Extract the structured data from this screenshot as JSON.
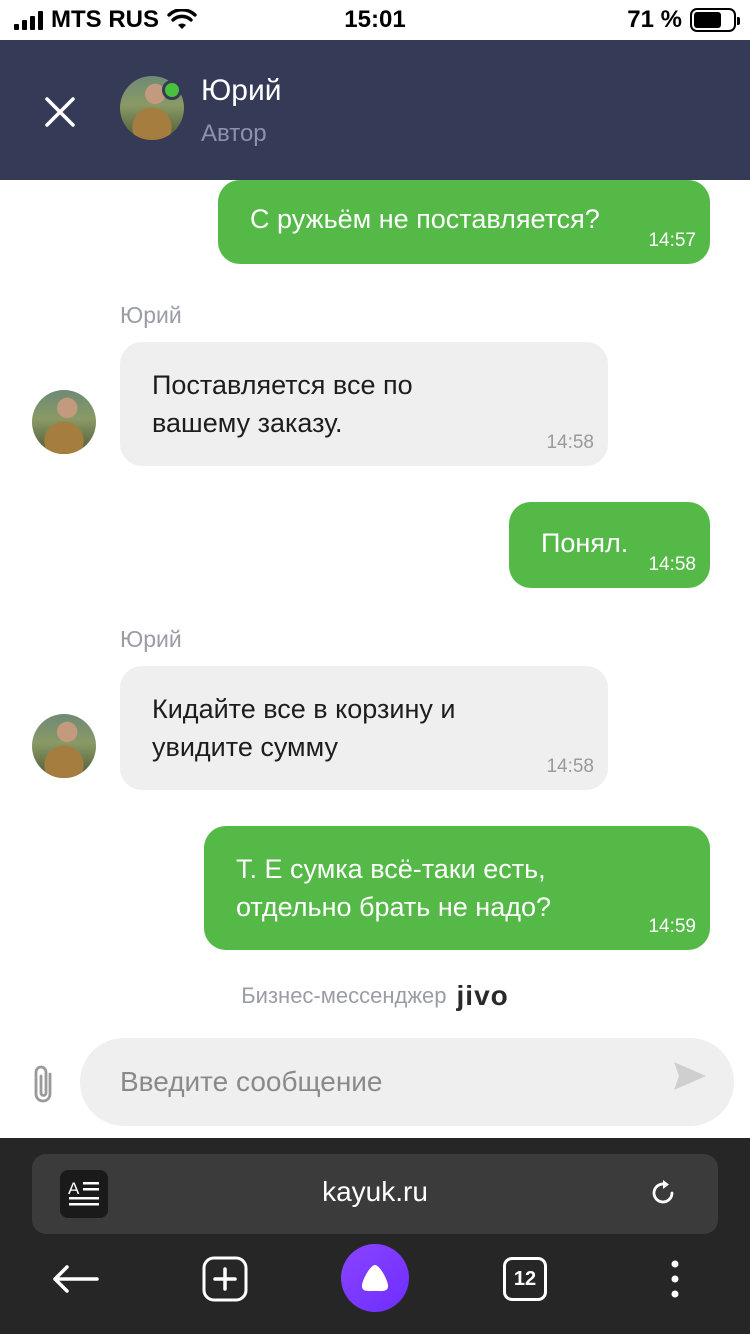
{
  "status_bar": {
    "carrier": "MTS RUS",
    "time": "15:01",
    "battery": "71 %",
    "battery_level": 0.71
  },
  "chat_header": {
    "name": "Юрий",
    "role": "Автор",
    "online": true,
    "online_color": "#4ac13b"
  },
  "messages": [
    {
      "direction": "out",
      "text": "С ружьём не поставляется?",
      "time": "14:57"
    },
    {
      "direction": "in",
      "sender": "Юрий",
      "lines": [
        "Поставляется все по",
        "вашему заказу."
      ],
      "time": "14:58"
    },
    {
      "direction": "out",
      "text": "Понял.",
      "time": "14:58"
    },
    {
      "direction": "in",
      "sender": "Юрий",
      "lines": [
        "Кидайте все в корзину и",
        "увидите сумму"
      ],
      "time": "14:58"
    },
    {
      "direction": "out",
      "lines": [
        "Т. Е сумка всё-таки есть,",
        "отдельно брать не надо?"
      ],
      "time": "14:59"
    }
  ],
  "powered_by": {
    "label": "Бизнес-мессенджер",
    "brand": "jivo"
  },
  "composer": {
    "placeholder": "Введите сообщение"
  },
  "browser": {
    "url": "kayuk.ru",
    "tabs_count": "12"
  },
  "colors": {
    "header_bg": "#353a56",
    "outgoing_bubble": "#55b948",
    "incoming_bubble": "#efefef",
    "browser_bg": "#262626",
    "assistant_accent": "#7a38ff"
  }
}
